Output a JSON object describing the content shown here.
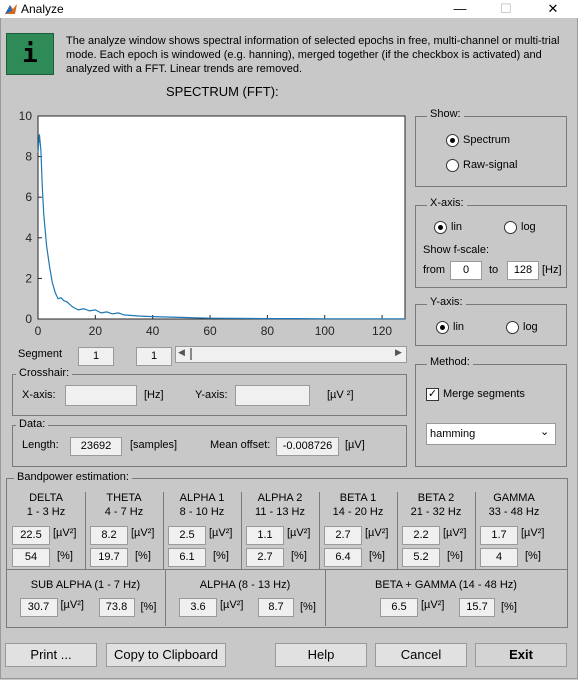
{
  "window": {
    "title": "Analyze",
    "minimize": "—",
    "maximize": "☐",
    "close": "✕"
  },
  "info": {
    "icon_letter": "i",
    "text": "The analyze window shows spectral information of selected epochs in free, multi-channel or multi-trial mode. Each epoch is windowed (e.g. hanning), merged together (if the checkbox is activated) and analyzed with a FFT. Linear trends are removed."
  },
  "chart_title": "SPECTRUM (FFT):",
  "chart_data": {
    "type": "line",
    "title": "SPECTRUM (FFT):",
    "xlabel": "",
    "ylabel": "",
    "xlim": [
      0,
      128
    ],
    "ylim": [
      0,
      10
    ],
    "xticks": [
      "0",
      "20",
      "40",
      "60",
      "80",
      "100",
      "120"
    ],
    "yticks": [
      "0",
      "2",
      "4",
      "6",
      "8",
      "10"
    ],
    "series": [
      {
        "color": "#1f77b4",
        "x": [
          0,
          0.5,
          1,
          1.5,
          2,
          3,
          4,
          5,
          6,
          7,
          8,
          9,
          10,
          12,
          14,
          16,
          18,
          20,
          22,
          24,
          26,
          28,
          30,
          35,
          40,
          45,
          50,
          55,
          60,
          70,
          80,
          90,
          100,
          110,
          120,
          128
        ],
        "y": [
          8.2,
          9.1,
          8.3,
          6.5,
          5.2,
          3.6,
          2.6,
          1.8,
          1.3,
          1.0,
          1.05,
          0.9,
          0.85,
          0.6,
          0.45,
          0.5,
          0.4,
          0.45,
          0.3,
          0.35,
          0.25,
          0.3,
          0.2,
          0.15,
          0.12,
          0.1,
          0.08,
          0.06,
          0.04,
          0.03,
          0.02,
          0.02,
          0.01,
          0.01,
          0.01,
          0.01
        ]
      }
    ]
  },
  "segment": {
    "label": "Segment",
    "value1": "1",
    "value2": "1"
  },
  "show": {
    "title": "Show:",
    "spectrum": "Spectrum",
    "raw": "Raw-signal",
    "selected": "spectrum"
  },
  "xaxis": {
    "title": "X-axis:",
    "lin": "lin",
    "log": "log",
    "selected": "lin",
    "fscale_label": "Show f-scale:",
    "from_label": "from",
    "from_value": "0",
    "to_label": "to",
    "to_value": "128",
    "unit": "[Hz]"
  },
  "yaxis": {
    "title": "Y-axis:",
    "lin": "lin",
    "log": "log",
    "selected": "lin"
  },
  "method": {
    "title": "Method:",
    "merge_label": "Merge segments",
    "merge_checked": true,
    "window": "hamming"
  },
  "crosshair": {
    "title": "Crosshair:",
    "x_label": "X-axis:",
    "x_value": "",
    "x_unit": "[Hz]",
    "y_label": "Y-axis:",
    "y_value": "",
    "y_unit": "[µV ²]"
  },
  "data": {
    "title": "Data:",
    "length_label": "Length:",
    "length_value": "23692",
    "length_unit": "[samples]",
    "offset_label": "Mean offset:",
    "offset_value": "-0.008726",
    "offset_unit": "[µV]"
  },
  "bandpower": {
    "title": "Bandpower estimation:",
    "unit_power": "[µV²]",
    "unit_percent": "[%]",
    "bands": [
      {
        "name": "DELTA",
        "range": "1 - 3 Hz",
        "power": "22.5",
        "percent": "54"
      },
      {
        "name": "THETA",
        "range": "4 - 7 Hz",
        "power": "8.2",
        "percent": "19.7"
      },
      {
        "name": "ALPHA 1",
        "range": "8 - 10 Hz",
        "power": "2.5",
        "percent": "6.1"
      },
      {
        "name": "ALPHA 2",
        "range": "11 - 13 Hz",
        "power": "1.1",
        "percent": "2.7"
      },
      {
        "name": "BETA 1",
        "range": "14 - 20 Hz",
        "power": "2.7",
        "percent": "6.4"
      },
      {
        "name": "BETA 2",
        "range": "21 - 32 Hz",
        "power": "2.2",
        "percent": "5.2"
      },
      {
        "name": "GAMMA",
        "range": "33 - 48 Hz",
        "power": "1.7",
        "percent": "4"
      }
    ],
    "combined": [
      {
        "name": "SUB ALPHA (1 - 7 Hz)",
        "power": "30.7",
        "percent": "73.8"
      },
      {
        "name": "ALPHA (8 - 13 Hz)",
        "power": "3.6",
        "percent": "8.7"
      },
      {
        "name": "BETA + GAMMA (14 - 48 Hz)",
        "power": "6.5",
        "percent": "15.7"
      }
    ]
  },
  "buttons": {
    "print": "Print ...",
    "clipboard": "Copy to Clipboard",
    "help": "Help",
    "cancel": "Cancel",
    "exit": "Exit"
  }
}
